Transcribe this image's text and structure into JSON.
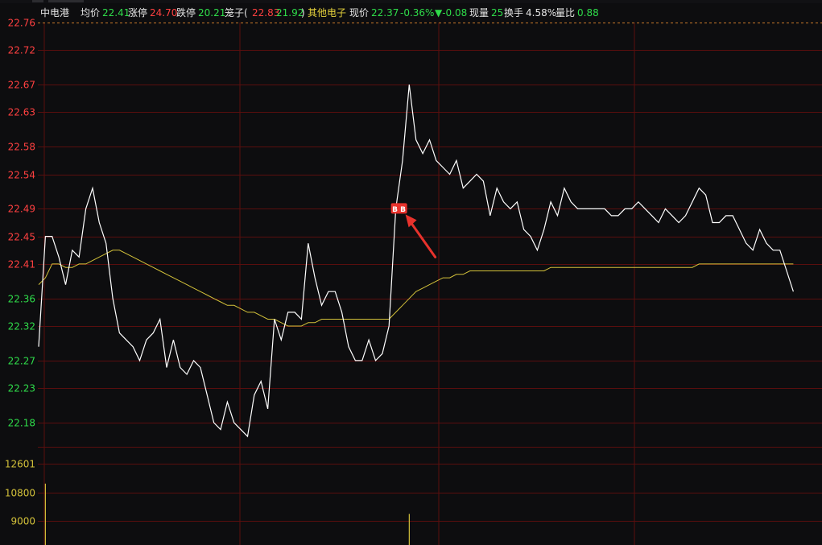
{
  "header": {
    "stock_name": "中电港",
    "avg_label": "均价",
    "avg_value": "22.41",
    "limit_up_label": "涨停",
    "limit_up_value": "24.70",
    "limit_down_label": "跌停",
    "limit_down_value": "20.21",
    "cage_label": "笼子(",
    "cage_high": "22.83",
    "cage_low": "21.92",
    "cage_close": ")",
    "sector": "其他电子",
    "price_label": "现价",
    "price_value": "22.37",
    "change_pct": "-0.36%",
    "change_abs": "▼-0.08",
    "cur_vol_label": "现量",
    "cur_vol_value": "25",
    "turnover_label": "换手",
    "turnover_value": "4.58%",
    "vol_ratio_label": "量比",
    "vol_ratio_value": "0.88"
  },
  "colors": {
    "background": "#0d0d0f",
    "grid": "#5a0e0e",
    "price_line": "#ffffff",
    "avg_line": "#d4c23a",
    "up": "#ff4040",
    "down": "#2fdc4a",
    "volume": "#d4c23a",
    "marker": "#e8322c"
  },
  "chart_data": [
    {
      "type": "line",
      "series": [
        {
          "values": [
            22.29,
            22.45,
            22.45,
            22.42,
            22.38,
            22.43,
            22.42,
            22.49,
            22.52,
            22.47,
            22.44,
            22.36,
            22.31,
            22.3,
            22.29,
            22.27,
            22.3,
            22.31,
            22.33,
            22.26,
            22.3,
            22.26,
            22.25,
            22.27,
            22.26,
            22.22,
            22.18,
            22.17,
            22.21,
            22.18,
            22.17,
            22.16,
            22.22,
            22.24,
            22.2,
            22.33,
            22.3,
            22.34,
            22.34,
            22.33,
            22.44,
            22.39,
            22.35,
            22.37,
            22.37,
            22.34,
            22.29,
            22.27,
            22.27,
            22.3,
            22.27,
            22.28,
            22.32,
            22.49,
            22.56,
            22.67,
            22.59,
            22.57,
            22.59,
            22.56,
            22.55,
            22.54,
            22.56,
            22.52,
            22.53,
            22.54,
            22.53,
            22.48,
            22.52,
            22.5,
            22.49,
            22.5,
            22.46,
            22.45,
            22.43,
            22.46,
            22.5,
            22.48,
            22.52,
            22.5,
            22.49,
            22.49,
            22.49,
            22.49,
            22.49,
            22.48,
            22.48,
            22.49,
            22.49,
            22.5,
            22.49,
            22.48,
            22.47,
            22.49,
            22.48,
            22.47,
            22.48,
            22.5,
            22.52,
            22.51,
            22.47,
            22.47,
            22.48,
            22.48,
            22.46,
            22.44,
            22.43,
            22.46,
            22.44,
            22.43,
            22.43,
            22.4,
            22.37
          ]
        },
        {
          "values": [
            22.38,
            22.39,
            22.41,
            22.41,
            22.405,
            22.405,
            22.41,
            22.41,
            22.415,
            22.42,
            22.425,
            22.43,
            22.43,
            22.425,
            22.42,
            22.415,
            22.41,
            22.405,
            22.4,
            22.395,
            22.39,
            22.385,
            22.38,
            22.375,
            22.37,
            22.365,
            22.36,
            22.355,
            22.35,
            22.35,
            22.345,
            22.34,
            22.34,
            22.335,
            22.33,
            22.33,
            22.325,
            22.32,
            22.32,
            22.32,
            22.325,
            22.325,
            22.33,
            22.33,
            22.33,
            22.33,
            22.33,
            22.33,
            22.33,
            22.33,
            22.33,
            22.33,
            22.33,
            22.34,
            22.35,
            22.36,
            22.37,
            22.375,
            22.38,
            22.385,
            22.39,
            22.39,
            22.395,
            22.395,
            22.4,
            22.4,
            22.4,
            22.4,
            22.4,
            22.4,
            22.4,
            22.4,
            22.4,
            22.4,
            22.4,
            22.4,
            22.405,
            22.405,
            22.405,
            22.405,
            22.405,
            22.405,
            22.405,
            22.405,
            22.405,
            22.405,
            22.405,
            22.405,
            22.405,
            22.405,
            22.405,
            22.405,
            22.405,
            22.405,
            22.405,
            22.405,
            22.405,
            22.405,
            22.41,
            22.41,
            22.41,
            22.41,
            22.41,
            22.41,
            22.41,
            22.41,
            22.41,
            22.41,
            22.41,
            22.41,
            22.41,
            22.41,
            22.41
          ]
        }
      ],
      "ylim": [
        22.145,
        22.76
      ],
      "yticks": [
        {
          "label": "22.76",
          "value": 22.76,
          "color": "up"
        },
        {
          "label": "22.72",
          "value": 22.72,
          "color": "up"
        },
        {
          "label": "22.67",
          "value": 22.67,
          "color": "up"
        },
        {
          "label": "22.63",
          "value": 22.63,
          "color": "up"
        },
        {
          "label": "22.58",
          "value": 22.58,
          "color": "up"
        },
        {
          "label": "22.54",
          "value": 22.54,
          "color": "up"
        },
        {
          "label": "22.49",
          "value": 22.49,
          "color": "up"
        },
        {
          "label": "22.45",
          "value": 22.45,
          "color": "up"
        },
        {
          "label": "22.41",
          "value": 22.41,
          "color": "up"
        },
        {
          "label": "22.36",
          "value": 22.36,
          "color": "down"
        },
        {
          "label": "22.32",
          "value": 22.32,
          "color": "down"
        },
        {
          "label": "22.27",
          "value": 22.27,
          "color": "down"
        },
        {
          "label": "22.23",
          "value": 22.23,
          "color": "down"
        },
        {
          "label": "22.18",
          "value": 22.18,
          "color": "down"
        }
      ],
      "annotation": {
        "label": "B B",
        "index": 53
      }
    },
    {
      "type": "bar",
      "ylim": [
        7500,
        12601
      ],
      "yticks": [
        {
          "label": "12601",
          "value": 12601
        },
        {
          "label": "10800",
          "value": 10800
        },
        {
          "label": "9000",
          "value": 9000
        }
      ],
      "bars": [
        {
          "index": 1,
          "value": 11350
        },
        {
          "index": 55,
          "value": 9450
        }
      ]
    }
  ]
}
